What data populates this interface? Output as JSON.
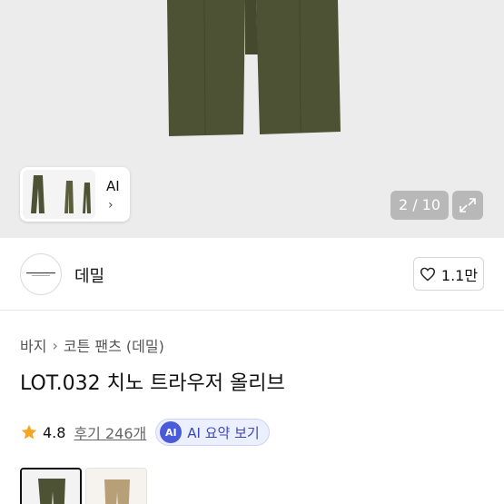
{
  "gallery": {
    "ai_label": "AI",
    "page_counter": "2 / 10"
  },
  "seller": {
    "name": "데밀",
    "likes": "1.1만"
  },
  "breadcrumb": {
    "category": "바지",
    "subcategory": "코튼 팬츠 (데밀)"
  },
  "product": {
    "title": "LOT.032 치노 트라우저 올리브",
    "rating": "4.8",
    "reviews": "후기 246개",
    "ai_badge": "AI",
    "ai_summary": "AI 요약 보기"
  },
  "colors": {
    "olive": "#4e5234",
    "khaki": "#b79f78",
    "ai_accent": "#4a5bd9",
    "star": "#f5a623"
  }
}
